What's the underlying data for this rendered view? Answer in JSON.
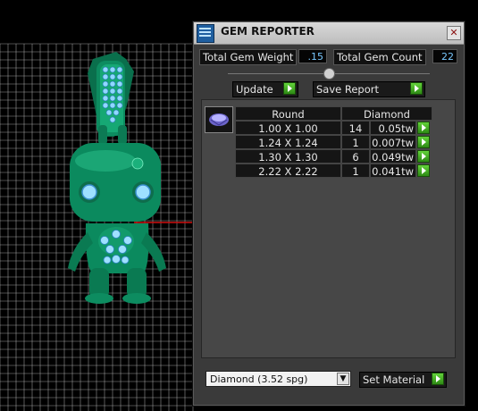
{
  "viewport": {
    "grid_color": "#c8c8c8",
    "axis_color": "#d01010",
    "model_color": "#0b8f62"
  },
  "panel": {
    "title": "GEM REPORTER",
    "close_glyph": "✕",
    "stats": {
      "weight_label": "Total Gem Weight",
      "weight_value": ".15",
      "count_label": "Total Gem Count",
      "count_value": "22"
    },
    "buttons": {
      "update": "Update",
      "save_report": "Save Report"
    },
    "table": {
      "headers": {
        "shape": "Round",
        "material": "Diamond"
      },
      "rows": [
        {
          "size": "1.00 X 1.00",
          "count": "14",
          "weight": "0.05tw"
        },
        {
          "size": "1.24 X 1.24",
          "count": "1",
          "weight": "0.007tw"
        },
        {
          "size": "1.30 X 1.30",
          "count": "6",
          "weight": "0.049tw"
        },
        {
          "size": "2.22 X 2.22",
          "count": "1",
          "weight": "0.041tw"
        }
      ]
    },
    "material_select": {
      "value": "Diamond     (3.52 spg)",
      "dropdown_glyph": "▼"
    },
    "set_material": "Set Material",
    "colors": {
      "accent_green": "#3cb51f",
      "value_blue": "#79c8ff",
      "panel_bg": "#3a3a3a"
    },
    "icons": [
      "app-icon",
      "close-icon",
      "splitter-knob",
      "play-arrow-icon",
      "gem-thumbnail-icon",
      "dropdown-arrow-icon"
    ]
  }
}
